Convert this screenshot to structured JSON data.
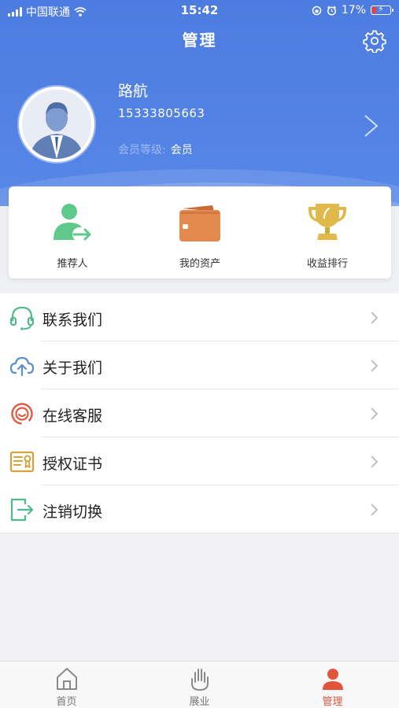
{
  "status_bar": {
    "carrier": "中国联通",
    "time": "15:42",
    "battery_percent": "17%"
  },
  "header": {
    "title": "管理",
    "settings_icon": "gear-icon"
  },
  "profile": {
    "name": "路航",
    "phone": "15333805663",
    "level_label": "会员等级:",
    "level_value": "会员"
  },
  "quick_actions": [
    {
      "label": "推荐人",
      "icon": "referrer-icon",
      "color": "#5fc88b"
    },
    {
      "label": "我的资产",
      "icon": "wallet-icon",
      "color": "#e58a4e"
    },
    {
      "label": "收益排行",
      "icon": "trophy-icon",
      "color": "#e0b94a"
    }
  ],
  "menu": [
    {
      "label": "联系我们",
      "icon": "headset-icon"
    },
    {
      "label": "关于我们",
      "icon": "cloud-upload-icon"
    },
    {
      "label": "在线客服",
      "icon": "customer-service-icon"
    },
    {
      "label": "授权证书",
      "icon": "certificate-icon"
    },
    {
      "label": "注销切换",
      "icon": "logout-icon"
    }
  ],
  "tabs": [
    {
      "label": "首页",
      "icon": "home-icon",
      "active": false
    },
    {
      "label": "展业",
      "icon": "hand-icon",
      "active": false
    },
    {
      "label": "管理",
      "icon": "user-icon",
      "active": true
    }
  ],
  "colors": {
    "header_blue": "#4d7ce0",
    "active_tab": "#e2553b"
  }
}
